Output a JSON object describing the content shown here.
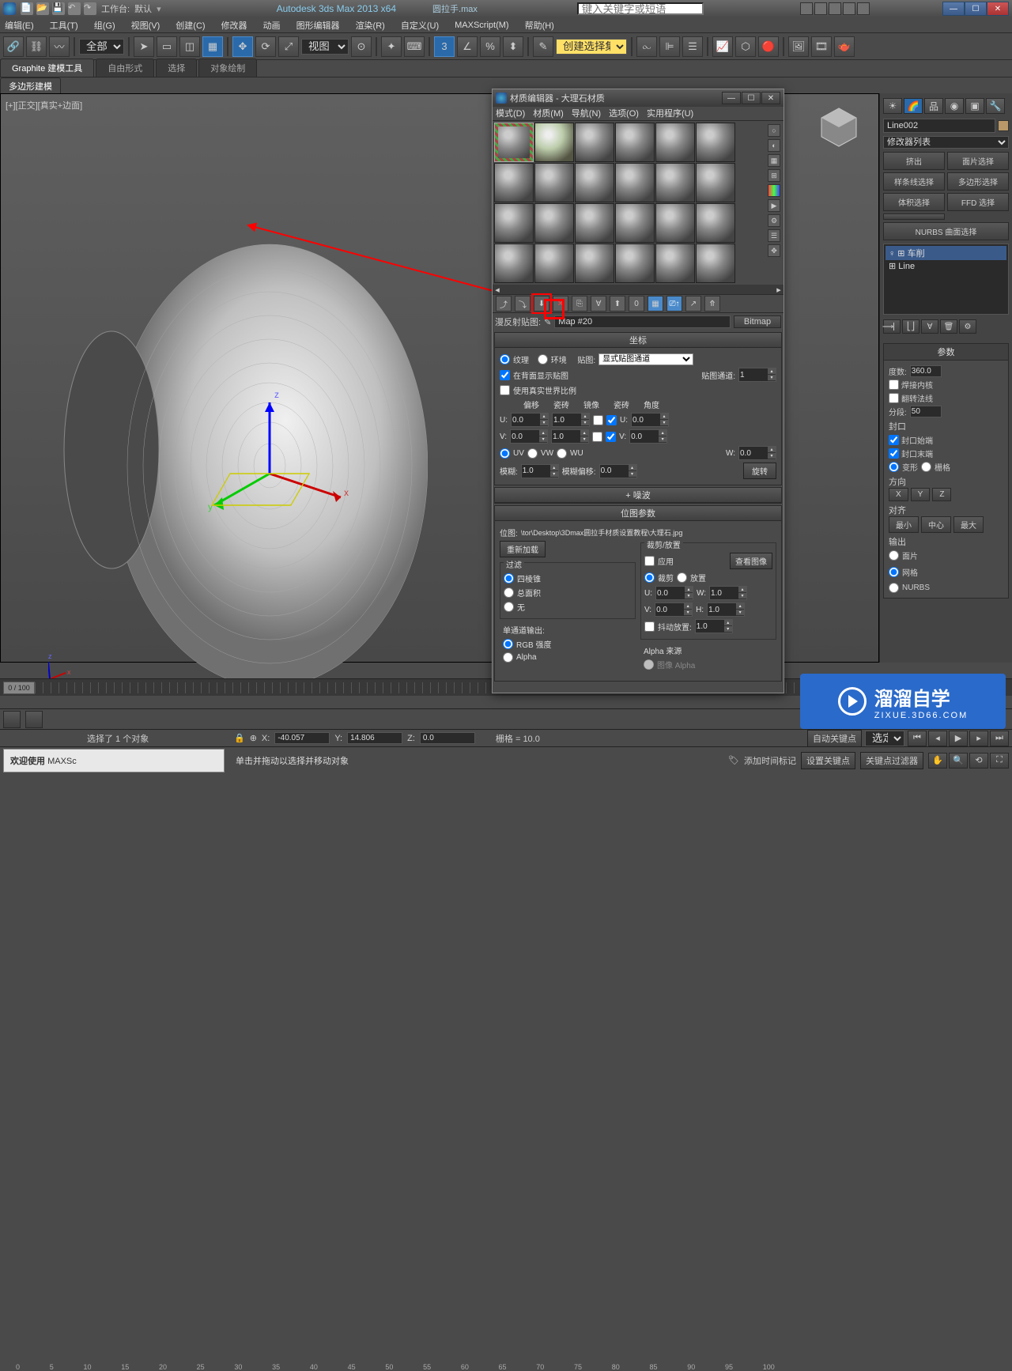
{
  "app": {
    "title": "Autodesk 3ds Max  2013 x64",
    "filename": "圆拉手.max",
    "workspace_label": "工作台:",
    "workspace_value": "默认",
    "search_placeholder": "键入关键字或短语"
  },
  "menu": [
    "编辑(E)",
    "工具(T)",
    "组(G)",
    "视图(V)",
    "创建(C)",
    "修改器",
    "动画",
    "图形编辑器",
    "渲染(R)",
    "自定义(U)",
    "MAXScript(M)",
    "帮助(H)"
  ],
  "toolbar": {
    "filter": "全部",
    "ref_label": "视图",
    "selset_label": "创建选择集"
  },
  "ribbon": {
    "tabs": [
      "Graphite 建模工具",
      "自由形式",
      "选择",
      "对象绘制"
    ],
    "subtab": "多边形建模"
  },
  "viewport": {
    "label": "[+][正交][真实+边面]"
  },
  "side": {
    "object_name": "Line002",
    "modifier_list_label": "修改器列表",
    "modifier_buttons": [
      "挤出",
      "面片选择",
      "样条线选择",
      "多边形选择",
      "体积选择",
      "FFD 选择",
      "",
      "NURBS 曲面选择"
    ],
    "mod_stack": [
      "车削",
      "Line"
    ],
    "params_title": "参数",
    "degrees_label": "度数:",
    "degrees_value": "360.0",
    "weld_label": "焊接内核",
    "flip_label": "翻转法线",
    "segments_label": "分段:",
    "segments_value": "50",
    "cap_title": "封口",
    "cap_start": "封口始端",
    "cap_end": "封口末端",
    "cap_type_morph": "变形",
    "cap_type_grid": "栅格",
    "dir_title": "方向",
    "dir_x": "X",
    "dir_y": "Y",
    "dir_z": "Z",
    "align_title": "对齐",
    "align_min": "最小",
    "align_center": "中心",
    "align_max": "最大",
    "output_title": "输出",
    "output_patch": "面片",
    "output_mesh": "网格",
    "output_nurbs": "NURBS"
  },
  "mat": {
    "window_title": "材质编辑器 - 大理石材质",
    "menu": [
      "模式(D)",
      "材质(M)",
      "导航(N)",
      "选项(O)",
      "实用程序(U)"
    ],
    "map_label": "漫反射贴图:",
    "map_name": "Map #20",
    "map_type": "Bitmap",
    "coord_title": "坐标",
    "texture": "纹理",
    "environ": "环境",
    "mapping_label": "贴图:",
    "mapping_type": "显式贴图通道",
    "show_back": "在背面显示贴图",
    "map_channel_label": "贴图通道:",
    "map_channel": "1",
    "real_world": "使用真实世界比例",
    "offset_label": "偏移",
    "tiling_label": "瓷砖",
    "mirror_label": "镜像",
    "tile_label": "瓷砖",
    "angle_label": "角度",
    "u_offset": "0.0",
    "v_offset": "0.0",
    "u_tile": "1.0",
    "v_tile": "1.0",
    "u_angle": "0.0",
    "v_angle": "0.0",
    "w_angle": "0.0",
    "uv": "UV",
    "vw": "VW",
    "wu": "WU",
    "blur_label": "模糊:",
    "blur": "1.0",
    "blur_offset_label": "模糊偏移:",
    "blur_offset": "0.0",
    "rotate": "旋转",
    "noise_title": "噪波",
    "bitmap_params_title": "位图参数",
    "bitmap_path_label": "位图:",
    "bitmap_path": "\\tor\\Desktop\\3Dmax圆拉手材质设置教程\\大理石.jpg",
    "reload": "重新加载",
    "crop_title": "裁剪/放置",
    "apply": "应用",
    "view_image": "查看图像",
    "crop": "裁剪",
    "place": "放置",
    "crop_u": "0.0",
    "crop_w": "1.0",
    "crop_v": "0.0",
    "crop_h": "1.0",
    "filter_title": "过滤",
    "filter_pyramid": "四棱锥",
    "filter_sat": "总面积",
    "filter_none": "无",
    "mono_title": "单通道输出:",
    "mono_rgb": "RGB 强度",
    "mono_alpha": "Alpha",
    "jitter": "抖动放置:",
    "jitter_val": "1.0",
    "alpha_source": "Alpha 来源",
    "alpha_image": "图像 Alpha"
  },
  "timeline": {
    "range": "0 / 100",
    "ticks": [
      "0",
      "5",
      "10",
      "15",
      "20",
      "25",
      "30",
      "35",
      "40",
      "45",
      "50",
      "55",
      "60",
      "65",
      "70",
      "75",
      "80",
      "85",
      "90",
      "95",
      "100"
    ]
  },
  "status": {
    "selection": "选择了 1 个对象",
    "welcome": "欢迎使用",
    "script": "MAXSc",
    "prompt": "单击并拖动以选择并移动对象",
    "x": "-40.057",
    "y": "14.806",
    "z": "0.0",
    "grid": "栅格 = 10.0",
    "add_time": "添加时间标记",
    "auto_key": "自动关键点",
    "set_key": "设置关键点",
    "sel_filter": "选定对",
    "key_filter": "关键点过滤器"
  },
  "brand": {
    "name": "溜溜自学",
    "url": "ZIXUE.3D66.COM"
  }
}
